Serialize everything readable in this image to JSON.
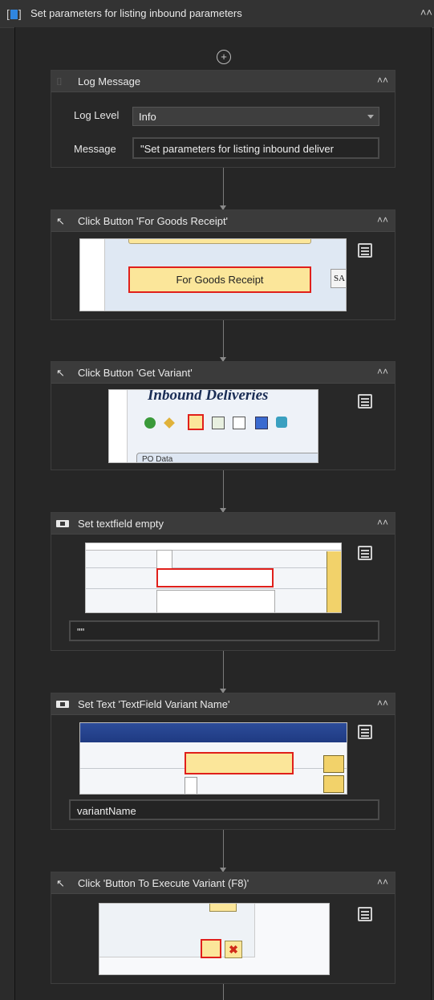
{
  "header": {
    "title": "Set parameters for listing inbound parameters"
  },
  "log_message": {
    "title": "Log Message",
    "log_level_label": "Log Level",
    "log_level_value": "Info",
    "message_label": "Message",
    "message_value": "\"Set parameters for listing inbound deliver"
  },
  "click_goods_receipt": {
    "title": "Click Button 'For Goods Receipt'",
    "shot_button": "For Goods Receipt",
    "shot_side": "SA"
  },
  "click_get_variant": {
    "title": "Click Button 'Get Variant'",
    "shot_heading": "Inbound Deliveries",
    "shot_footer": "PO Data"
  },
  "set_textfield_empty": {
    "title": "Set textfield empty",
    "input_value": "\"\""
  },
  "set_text_variant": {
    "title": "Set Text 'TextField  Variant Name'",
    "input_value": "variantName"
  },
  "click_execute": {
    "title": "Click 'Button To Execute Variant (F8)'"
  },
  "colors": {
    "accent": "#2f86e0",
    "highlight": "#e0201b",
    "sap_yellow": "#fbe69a"
  }
}
